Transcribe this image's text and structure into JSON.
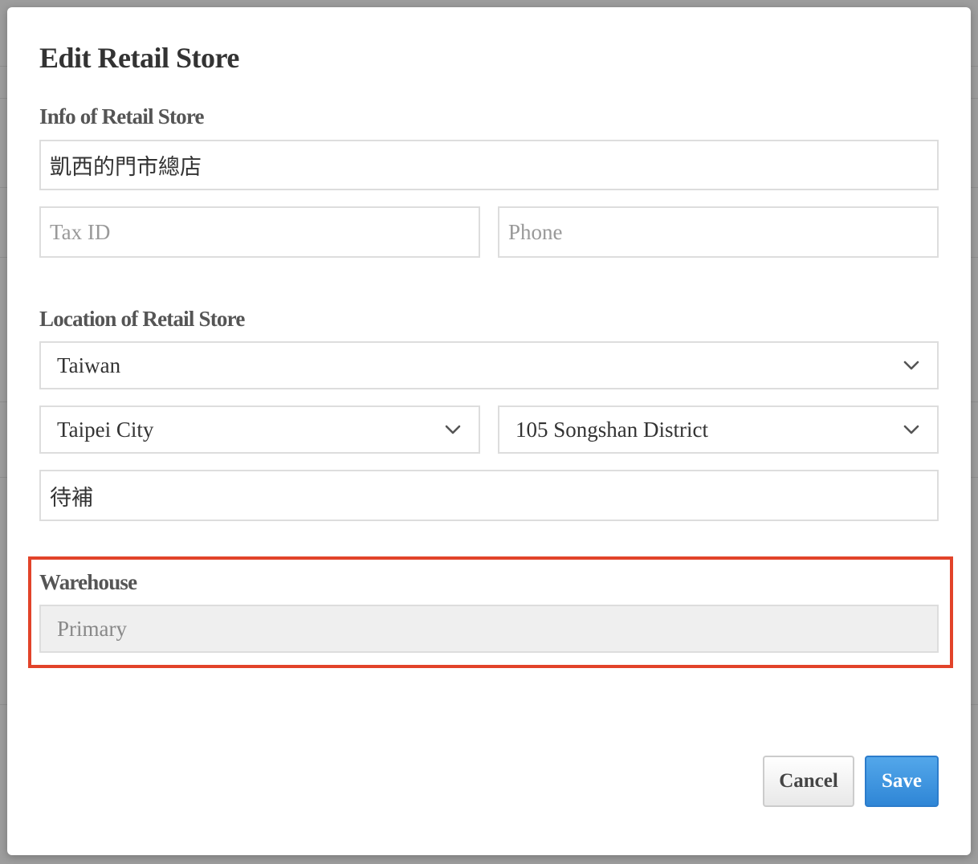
{
  "dialog": {
    "title": "Edit Retail Store"
  },
  "info_section": {
    "label": "Info of Retail Store",
    "store_name_value": "凱西的門市總店",
    "tax_id_placeholder": "Tax ID",
    "phone_placeholder": "Phone"
  },
  "location_section": {
    "label": "Location of Retail Store",
    "country": "Taiwan",
    "city": "Taipei City",
    "district": "105 Songshan District",
    "address_value": "待補"
  },
  "warehouse_section": {
    "label": "Warehouse",
    "value": "Primary",
    "highlight_color": "#e2432a"
  },
  "footer": {
    "cancel_label": "Cancel",
    "save_label": "Save"
  },
  "colors": {
    "primary_button": "#3a8fdc",
    "field_border": "#dddddd",
    "disabled_field": "#efefef"
  },
  "icons": {
    "dropdown": "chevron-down-icon"
  }
}
